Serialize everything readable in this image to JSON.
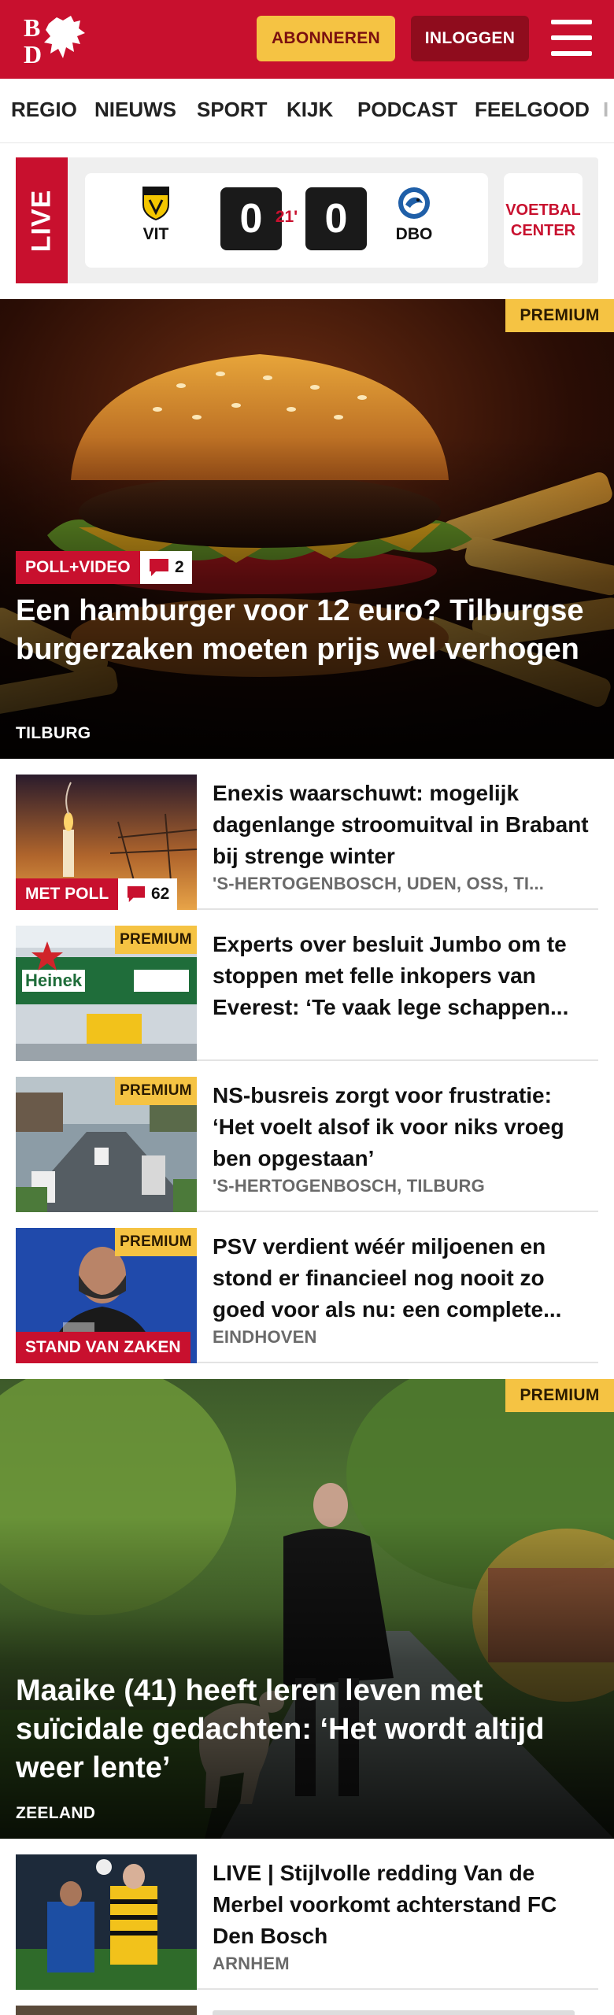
{
  "header": {
    "logo_text": "BD",
    "subscribe_label": "ABONNEREN",
    "login_label": "INLOGGEN",
    "menu_icon": "hamburger-menu-icon",
    "brand_color": "#c8102e"
  },
  "nav": {
    "items": [
      "REGIO",
      "NIEUWS",
      "SPORT",
      "KIJK",
      "PODCAST",
      "FEELGOOD",
      "I"
    ]
  },
  "live": {
    "tag": "LIVE",
    "home": {
      "abbr": "VIT",
      "score": "0"
    },
    "away": {
      "abbr": "DBO",
      "score": "0"
    },
    "minute": "21'",
    "center_label": "VOETBAL CENTER"
  },
  "hero1": {
    "premium": "PREMIUM",
    "badge": "POLL+VIDEO",
    "comments": "2",
    "title": "Een hamburger voor 12 euro? Tilburgse burgerzaken moeten prijs wel verhogen",
    "location": "TILBURG"
  },
  "articles": [
    {
      "title": "Enexis waarschuwt: mogelijk dagenlange stroomuitval in Brabant bij strenge winter",
      "location": "'S-HERTOGENBOSCH, UDEN, OSS, TI...",
      "label": "MET POLL",
      "comments": "62"
    },
    {
      "premium": "PREMIUM",
      "title": "Experts over besluit Jumbo om te stoppen met felle inkopers van Everest: ‘Te vaak lege schappen...",
      "location": ""
    },
    {
      "premium": "PREMIUM",
      "title": "NS-busreis zorgt voor frustratie: ‘Het voelt alsof ik voor niks vroeg ben opgestaan’",
      "location": "'S-HERTOGENBOSCH, TILBURG"
    },
    {
      "premium": "PREMIUM",
      "title": "PSV verdient wéér miljoenen en stond er financieel nog nooit zo goed voor als nu: een complete...",
      "location": "EINDHOVEN",
      "label": "STAND VAN ZAKEN"
    }
  ],
  "hero2": {
    "premium": "PREMIUM",
    "title": "Maaike (41) heeft leren leven met suïcidale gedachten: ‘Het wordt altijd weer lente’",
    "location": "ZEELAND"
  },
  "articles2": [
    {
      "title": "LIVE | Stijlvolle redding Van de Merbel voorkomt achterstand FC Den Bosch",
      "location": "ARNHEM"
    }
  ]
}
